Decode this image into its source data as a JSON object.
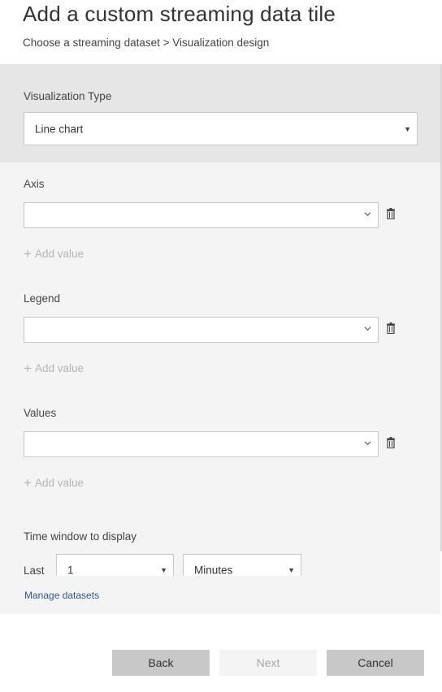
{
  "header": {
    "title": "Add a custom streaming data tile",
    "breadcrumb": "Choose a streaming dataset > Visualization design"
  },
  "visualization": {
    "label": "Visualization Type",
    "selected": "Line chart"
  },
  "axis": {
    "label": "Axis",
    "value": "",
    "add_value": "Add value"
  },
  "legend": {
    "label": "Legend",
    "value": "",
    "add_value": "Add value"
  },
  "values": {
    "label": "Values",
    "value": "",
    "add_value": "Add value"
  },
  "time_window": {
    "label": "Time window to display",
    "last_label": "Last",
    "amount": "1",
    "unit": "Minutes"
  },
  "links": {
    "manage_datasets": "Manage datasets"
  },
  "footer": {
    "back": "Back",
    "next": "Next",
    "cancel": "Cancel"
  },
  "colors": {
    "accent_link": "#2b579a",
    "pane_background": "#f4f4f4",
    "band_background": "#e6e6e6",
    "button_background": "#c8c8c8",
    "disabled_text": "#a6a6a6"
  },
  "icons": {
    "dropdown_solid": "caret-down-icon",
    "dropdown_chevron": "chevron-down-icon",
    "delete": "trash-icon",
    "add": "plus-icon"
  }
}
